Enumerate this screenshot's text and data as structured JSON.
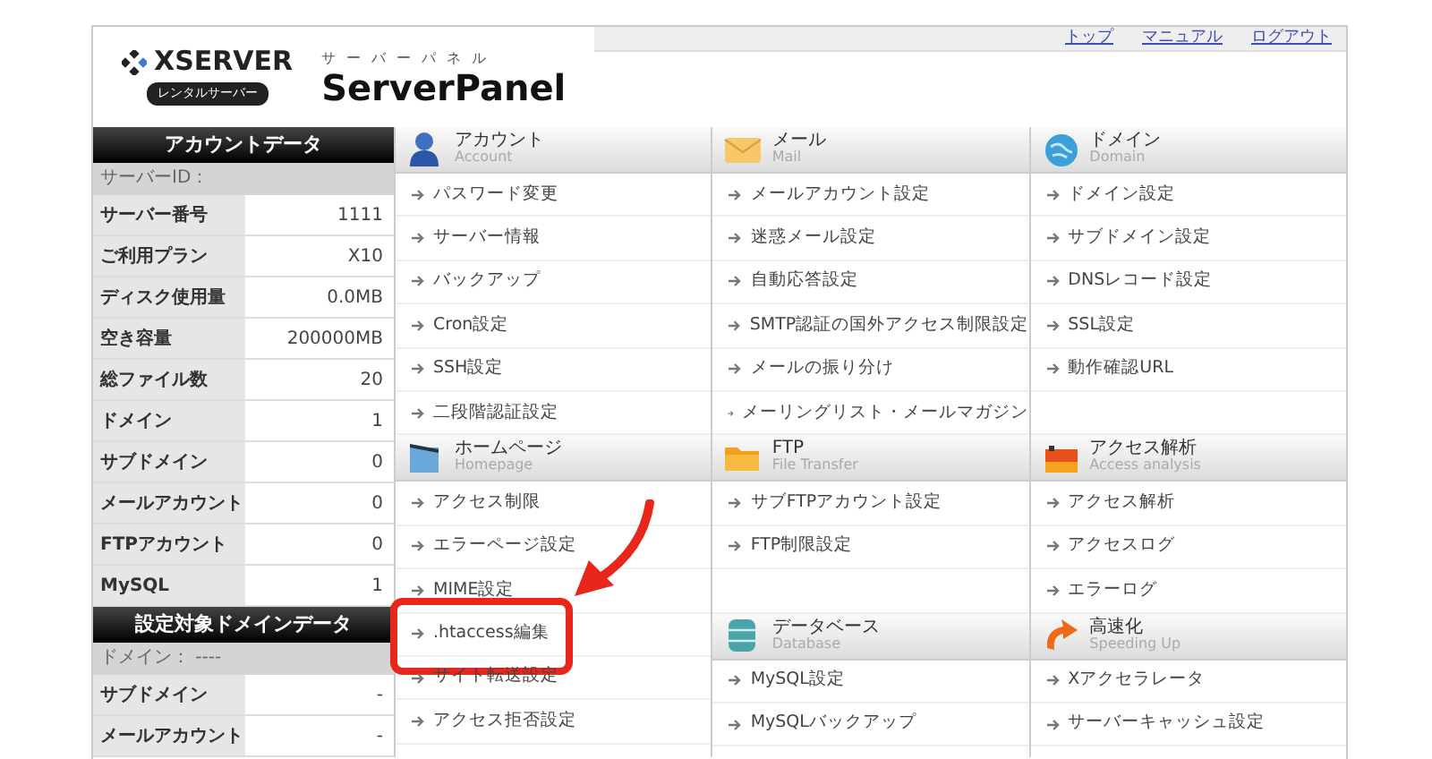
{
  "header": {
    "logo": "XSERVER",
    "logo_badge": "レンタルサーバー",
    "subtitle": "サーバーパネル",
    "title": "ServerPanel",
    "links": [
      "トップ",
      "マニュアル",
      "ログアウト"
    ]
  },
  "sidebar": [
    {
      "title": "アカウントデータ",
      "subheading": "サーバーID：",
      "rows": [
        {
          "label": "サーバー番号",
          "value": "1111"
        },
        {
          "label": "ご利用プラン",
          "value": "X10"
        },
        {
          "label": "ディスク使用量",
          "value": "0.0MB"
        },
        {
          "label": "空き容量",
          "value": "200000MB"
        },
        {
          "label": "総ファイル数",
          "value": "20"
        },
        {
          "label": "ドメイン",
          "value": "1"
        },
        {
          "label": "サブドメイン",
          "value": "0"
        },
        {
          "label": "メールアカウント",
          "value": "0"
        },
        {
          "label": "FTPアカウント",
          "value": "0"
        },
        {
          "label": "MySQL",
          "value": "1"
        }
      ]
    },
    {
      "title": "設定対象ドメインデータ",
      "subheading": "ドメイン： ----",
      "rows": [
        {
          "label": "サブドメイン",
          "value": "-"
        },
        {
          "label": "メールアカウント",
          "value": "-"
        }
      ]
    }
  ],
  "columns": [
    [
      {
        "kind": "person",
        "title": "アカウント",
        "subtitle": "Account",
        "items": [
          {
            "label": "パスワード変更",
            "highlighted": false
          },
          {
            "label": "サーバー情報",
            "highlighted": false
          },
          {
            "label": "バックアップ",
            "highlighted": false
          },
          {
            "label": "Cron設定",
            "highlighted": false
          },
          {
            "label": "SSH設定",
            "highlighted": false
          },
          {
            "label": "二段階認証設定",
            "highlighted": false
          }
        ]
      },
      {
        "kind": "page",
        "title": "ホームページ",
        "subtitle": "Homepage",
        "items": [
          {
            "label": "アクセス制限",
            "highlighted": false
          },
          {
            "label": "エラーページ設定",
            "highlighted": false
          },
          {
            "label": "MIME設定",
            "highlighted": false
          },
          {
            "label": ".htaccess編集",
            "highlighted": true
          },
          {
            "label": "サイト転送設定",
            "highlighted": false
          },
          {
            "label": "アクセス拒否設定",
            "highlighted": false
          }
        ]
      }
    ],
    [
      {
        "kind": "envelope",
        "title": "メール",
        "subtitle": "Mail",
        "items": [
          {
            "label": "メールアカウント設定",
            "highlighted": false
          },
          {
            "label": "迷惑メール設定",
            "highlighted": false
          },
          {
            "label": "自動応答設定",
            "highlighted": false
          },
          {
            "label": "SMTP認証の国外アクセス制限設定",
            "highlighted": false
          },
          {
            "label": "メールの振り分け",
            "highlighted": false
          },
          {
            "label": "メーリングリスト・メールマガジン",
            "highlighted": false
          }
        ]
      },
      {
        "kind": "folder",
        "title": "FTP",
        "subtitle": "File Transfer",
        "items": [
          {
            "label": "サブFTPアカウント設定",
            "highlighted": false
          },
          {
            "label": "FTP制限設定",
            "highlighted": false
          }
        ]
      },
      {
        "kind": "database",
        "title": "データベース",
        "subtitle": "Database",
        "items": [
          {
            "label": "MySQL設定",
            "highlighted": false
          },
          {
            "label": "MySQLバックアップ",
            "highlighted": false
          }
        ]
      }
    ],
    [
      {
        "kind": "globe",
        "title": "ドメイン",
        "subtitle": "Domain",
        "items": [
          {
            "label": "ドメイン設定",
            "highlighted": false
          },
          {
            "label": "サブドメイン設定",
            "highlighted": false
          },
          {
            "label": "DNSレコード設定",
            "highlighted": false
          },
          {
            "label": "SSL設定",
            "highlighted": false
          },
          {
            "label": "動作確認URL",
            "highlighted": false
          }
        ]
      },
      {
        "kind": "chart",
        "title": "アクセス解析",
        "subtitle": "Access analysis",
        "items": [
          {
            "label": "アクセス解析",
            "highlighted": false
          },
          {
            "label": "アクセスログ",
            "highlighted": false
          },
          {
            "label": "エラーログ",
            "highlighted": false
          }
        ]
      },
      {
        "kind": "speed",
        "title": "高速化",
        "subtitle": "Speeding Up",
        "items": [
          {
            "label": "Xアクセラレータ",
            "highlighted": false
          },
          {
            "label": "サーバーキャッシュ設定",
            "highlighted": false
          }
        ]
      }
    ]
  ]
}
